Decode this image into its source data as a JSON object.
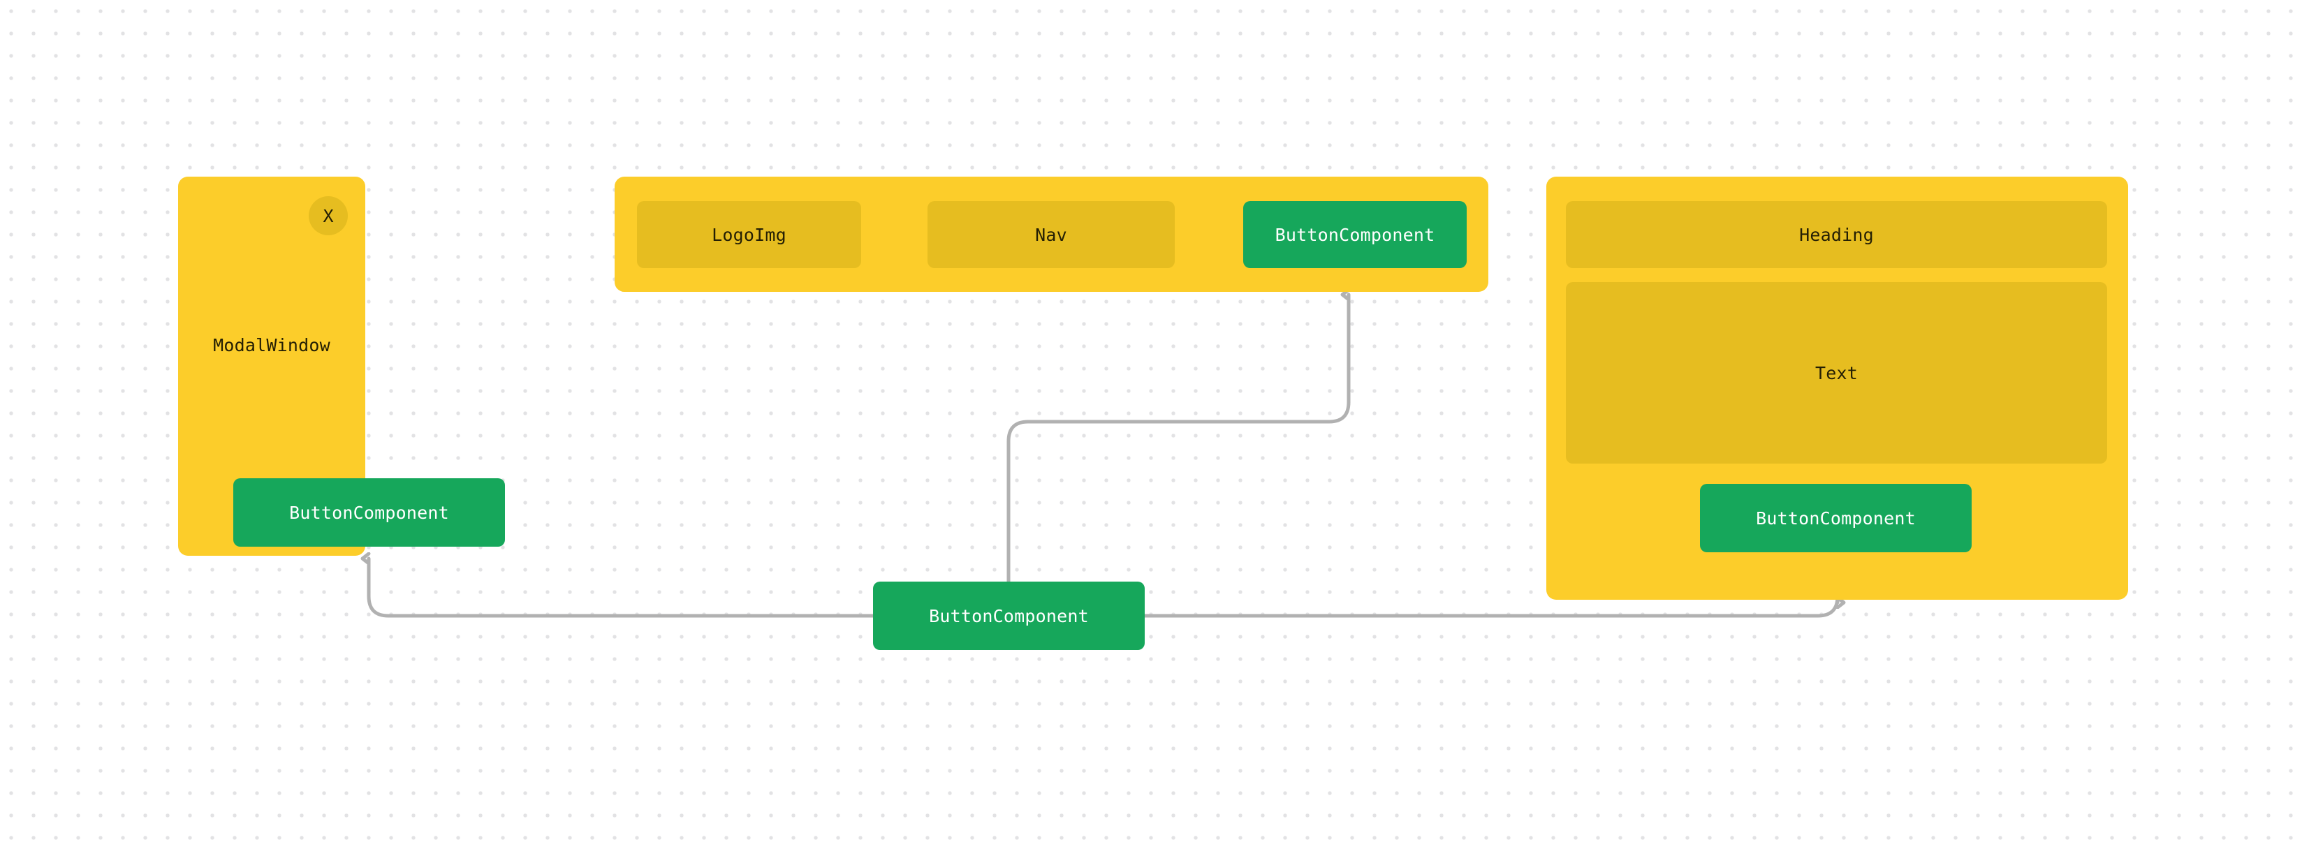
{
  "canvas": {
    "background_color": "#ffffff",
    "dot_grid_color": "#e2e2e4",
    "dot_spacing_px": 32
  },
  "palette": {
    "card_yellow": "#fccd2a",
    "inner_yellow": "#e6bd20",
    "button_green": "#16a75b",
    "edge_gray": "#b1b1b1",
    "dark_text": "#241f04",
    "light_text": "#ffffff"
  },
  "nodes": {
    "modal": {
      "title": "ModalWindow",
      "close_label": "X",
      "button_label": "ButtonComponent"
    },
    "navbar": {
      "logo_label": "LogoImg",
      "nav_label": "Nav",
      "button_label": "ButtonComponent"
    },
    "content": {
      "heading_label": "Heading",
      "text_label": "Text",
      "button_label": "ButtonComponent"
    },
    "center": {
      "label": "ButtonComponent"
    }
  },
  "edges": [
    {
      "id": "center-to-modal",
      "from": "center",
      "to": "modal-button",
      "direction": "left-then-up",
      "arrowhead": "up"
    },
    {
      "id": "center-to-navbar",
      "from": "center",
      "to": "navbar-button",
      "direction": "up-then-right-then-up",
      "arrowhead": "up"
    },
    {
      "id": "center-to-content",
      "from": "center",
      "to": "content-button",
      "direction": "right-then-up",
      "arrowhead": "up"
    }
  ]
}
